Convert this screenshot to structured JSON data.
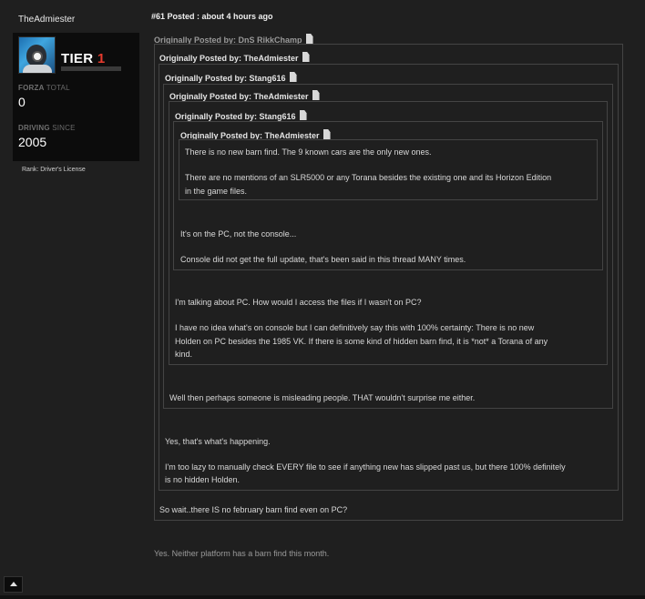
{
  "user": {
    "username": "TheAdmiester",
    "tier_label": "TIER",
    "tier_number": "1",
    "forza_label": "FORZA",
    "forza_sub": "TOTAL",
    "forza_value": "0",
    "driving_label": "DRIVING",
    "driving_sub": "SINCE",
    "driving_value": "2005",
    "rank": "Rank: Driver's License"
  },
  "post": {
    "header": "#61 Posted : about 4 hours ago",
    "quotes": [
      {
        "head": "Originally Posted by: DnS RikkChamp"
      },
      {
        "head": "Originally Posted by: TheAdmiester"
      },
      {
        "head": "Originally Posted by: Stang616"
      },
      {
        "head": "Originally Posted by: TheAdmiester"
      },
      {
        "head": "Originally Posted by: Stang616"
      },
      {
        "head": "Originally Posted by: TheAdmiester"
      }
    ],
    "innermost": {
      "p1": "There is no new barn find. The 9 known cars are the only new ones.",
      "p2a": "There are no mentions of an SLR5000 or any Torana besides the existing one and its Horizon Edition",
      "p2b": "in the game files."
    },
    "level5": {
      "p1": "It's on the PC, not the console...",
      "p2": "Console did not get the full update, that's been said in this thread MANY times."
    },
    "level4": {
      "p1": "I'm talking about PC. How would I access the files if I wasn't on PC?",
      "p2a": "I have no idea what's on console but I can definitively say this with 100% certainty: There is no new",
      "p2b": "Holden on PC besides the 1985 VK. If there is some kind of hidden barn find, it is *not* a Torana of any",
      "p2c": "kind."
    },
    "level3": {
      "p1": "Well then perhaps someone is misleading people. THAT wouldn't surprise me either."
    },
    "level2": {
      "p1": "Yes, that's what's happening.",
      "p2a": "I'm too lazy to manually check EVERY file to see if anything new has slipped past us, but there 100% definitely",
      "p2b": "is no hidden Holden."
    },
    "level1": {
      "p1": "So wait..there IS no february barn find even on PC?"
    },
    "reply": "Yes. Neither platform has a barn find this month."
  },
  "colors": {
    "background": "#1f1f1f",
    "panel": "#0c0c0c",
    "tier_accent": "#e63b2e",
    "quote_border": "#444444"
  },
  "icons": {
    "quote_source": "document-icon",
    "scroll_top": "arrow-up-icon"
  }
}
